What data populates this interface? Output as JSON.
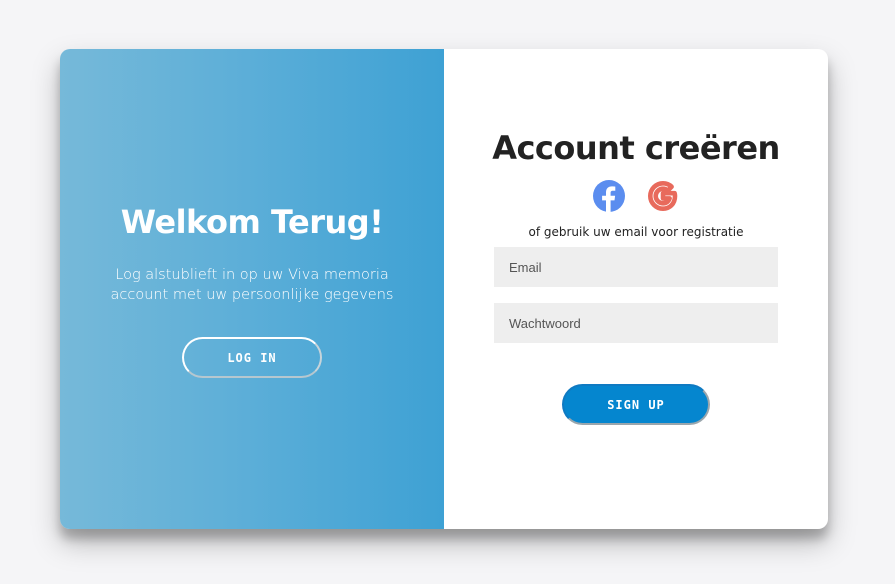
{
  "overlay": {
    "title": "Welkom Terug!",
    "text": "Log alstublieft in op uw Viva memoria account met uw persoonlijke gegevens",
    "button_label": "LOG IN"
  },
  "form": {
    "title": "Account creëren",
    "social": [
      {
        "icon": "facebook-icon",
        "color": "#5b8def"
      },
      {
        "icon": "google-icon",
        "color": "#e86a5c"
      }
    ],
    "subtext": "of gebruik uw email voor registratie",
    "email_placeholder": "Email",
    "password_placeholder": "Wachtwoord",
    "button_label": "SIGN UP"
  },
  "colors": {
    "accent": "#0586cf",
    "overlay_start": "#76b9d9",
    "overlay_end": "#3ea1d4"
  }
}
